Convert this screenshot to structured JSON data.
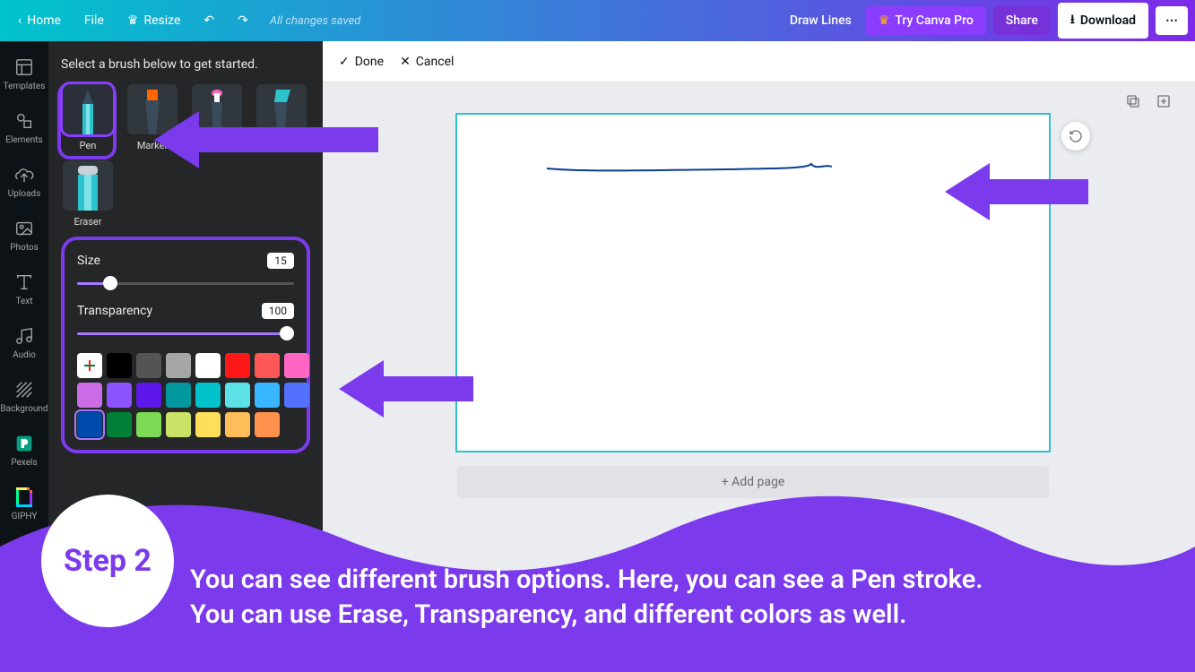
{
  "topbar": {
    "home": "Home",
    "file": "File",
    "resize": "Resize",
    "saved": "All changes saved",
    "doc_title": "Draw Lines",
    "try_pro": "Try Canva Pro",
    "share": "Share",
    "download": "Download"
  },
  "rail": {
    "templates": "Templates",
    "elements": "Elements",
    "uploads": "Uploads",
    "photos": "Photos",
    "text": "Text",
    "audio": "Audio",
    "background": "Background",
    "pexels": "Pexels",
    "giphy": "GIPHY"
  },
  "panel": {
    "title": "Select a brush below to get started.",
    "brushes": {
      "pen": "Pen",
      "marker": "Marker",
      "glow": "Glow pen",
      "highlighter": "Highlighter",
      "eraser": "Eraser"
    },
    "size_label": "Size",
    "size_value": "15",
    "transparency_label": "Transparency",
    "transparency_value": "100",
    "colors_row1": [
      "#000000",
      "#545454",
      "#a6a6a6",
      "#ffffff",
      "#ff1616",
      "#ff5757",
      "#ff66c4"
    ],
    "colors_row2": [
      "#cb6ce6",
      "#8c52ff",
      "#5e17eb",
      "#03989e",
      "#00c2cb",
      "#5ce1e6",
      "#38b6ff",
      "#5271ff"
    ],
    "colors_row3": [
      "#004aad",
      "#008037",
      "#7ed957",
      "#c9e265",
      "#ffde59",
      "#ffbd59",
      "#ff914d"
    ]
  },
  "actionbar": {
    "done": "Done",
    "cancel": "Cancel"
  },
  "canvas": {
    "add_page": "+ Add page"
  },
  "tutorial": {
    "step_label": "Step 2",
    "line1": "You can see different brush options. Here, you can see a Pen stroke.",
    "line2": "You can use Erase, Transparency, and different colors as well."
  }
}
